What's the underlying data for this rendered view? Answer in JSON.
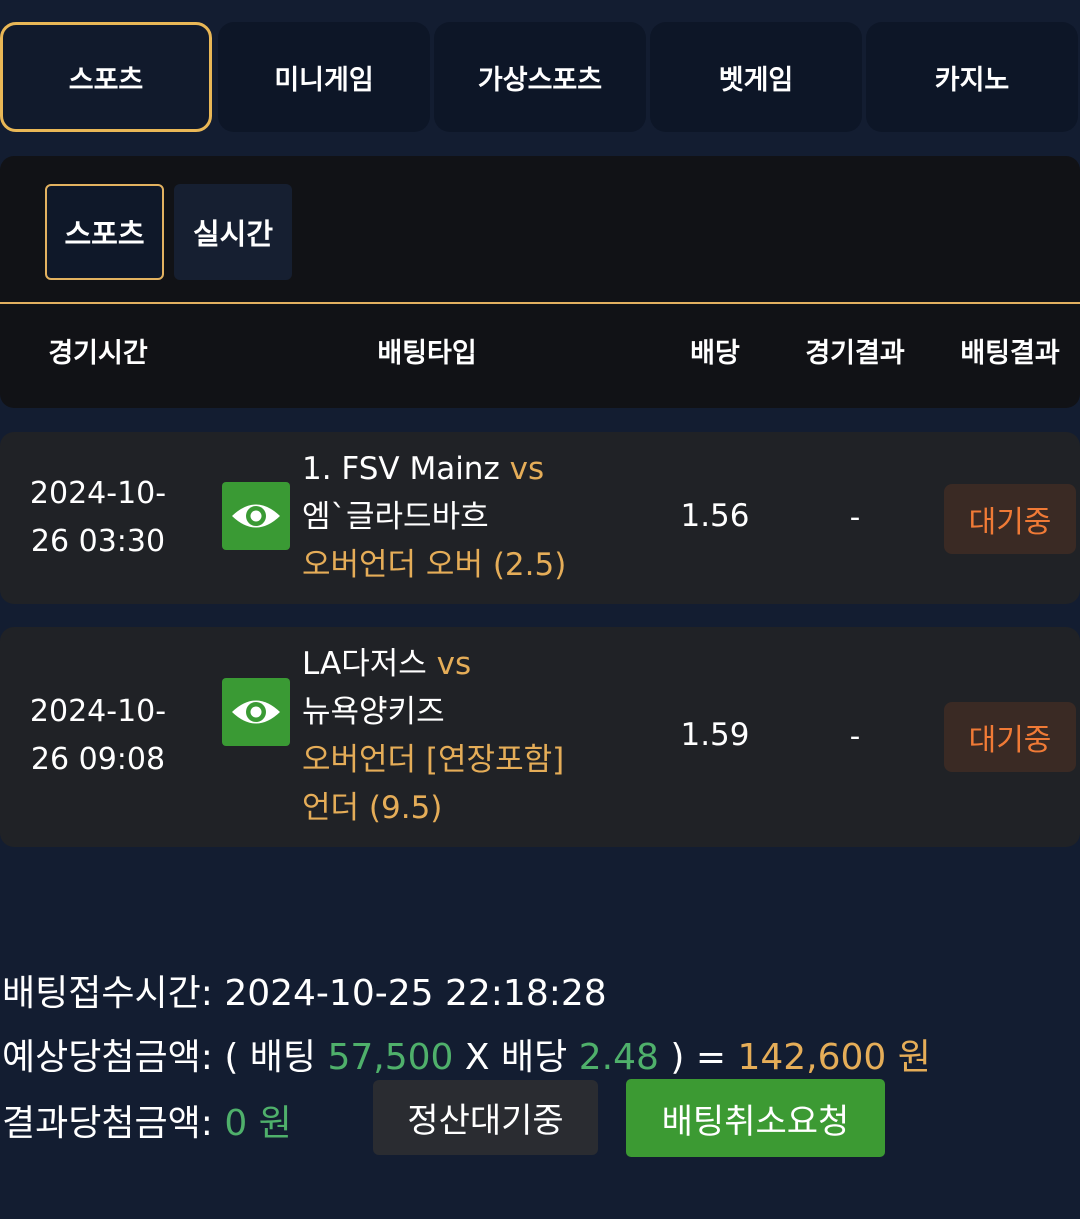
{
  "top_tabs": [
    "스포츠",
    "미니게임",
    "가상스포츠",
    "벳게임",
    "카지노"
  ],
  "sub_tabs": [
    "스포츠",
    "실시간"
  ],
  "columns": {
    "time": "경기시간",
    "bet_type": "배팅타입",
    "odds": "배당",
    "game_result": "경기결과",
    "bet_result": "배팅결과"
  },
  "bets": [
    {
      "time_line1": "2024-10-",
      "time_line2": "26 03:30",
      "home": "1. FSV Mainz",
      "vs": "vs",
      "away": "엠`글라드바흐",
      "market_line1": "오버언더 오버 (2.5)",
      "market_line2": "",
      "odds": "1.56",
      "game_result": "-",
      "status": "대기중"
    },
    {
      "time_line1": "2024-10-",
      "time_line2": "26 09:08",
      "home": "LA다저스",
      "vs": "vs",
      "away": "뉴욕양키즈",
      "market_line1": "오버언더 [연장포함]",
      "market_line2": "언더 (9.5)",
      "odds": "1.59",
      "game_result": "-",
      "status": "대기중"
    }
  ],
  "summary": {
    "received_label": "배팅접수시간:",
    "received_value": "2024-10-25 22:18:28",
    "expected_label": "예상당첨금액:",
    "expected_open": "( 배팅",
    "stake": "57,500",
    "multiply_label": "X 배당",
    "total_odds": "2.48",
    "equals": ") =",
    "expected_amount": "142,600 원",
    "result_label": "결과당첨금액:",
    "result_amount": "0 원"
  },
  "buttons": {
    "pending": "정산대기중",
    "cancel": "배팅취소요청"
  },
  "colors": {
    "background": "#131d31",
    "accent_gold": "#e5ad58",
    "green": "#3c9a33",
    "status_orange": "#f07a36"
  }
}
